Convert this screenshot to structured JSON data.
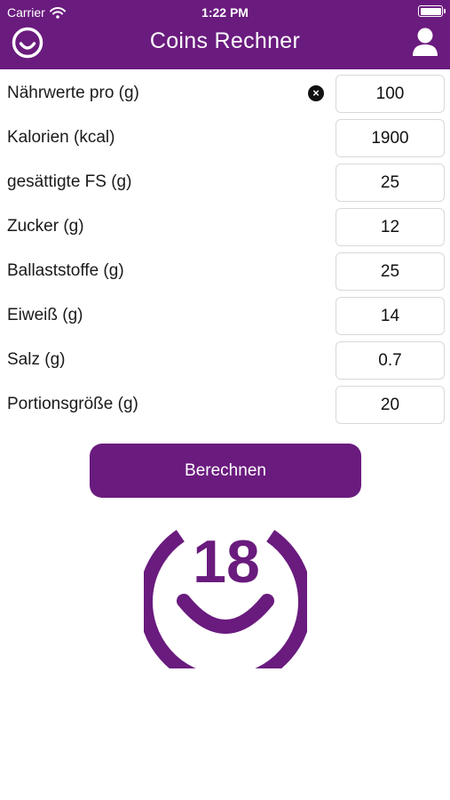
{
  "status_bar": {
    "carrier": "Carrier",
    "time": "1:22 PM",
    "battery_level": 1.0,
    "wifi_icon": "wifi-icon",
    "battery_icon": "battery-icon"
  },
  "nav": {
    "title": "Coins Rechner",
    "left_icon": "smiley-logo-icon",
    "right_icon": "user-profile-icon"
  },
  "form": {
    "rows": [
      {
        "label": "Nährwerte pro (g)",
        "value": "100",
        "has_clear": true
      },
      {
        "label": "Kalorien (kcal)",
        "value": "1900"
      },
      {
        "label": "gesättigte FS (g)",
        "value": "25"
      },
      {
        "label": "Zucker (g)",
        "value": "12"
      },
      {
        "label": "Ballaststoffe (g)",
        "value": "25"
      },
      {
        "label": "Eiweiß (g)",
        "value": "14"
      },
      {
        "label": "Salz (g)",
        "value": "0.7"
      },
      {
        "label": "Portionsgröße (g)",
        "value": "20"
      }
    ],
    "clear_icon": "clear-circle-icon"
  },
  "button": {
    "label": "Berechnen"
  },
  "result": {
    "value": "18",
    "icon": "smiley-logo-icon"
  },
  "colors": {
    "brand": "#6a1b7e",
    "text": "#1a1a1a",
    "input_border": "#d8d8d8"
  }
}
